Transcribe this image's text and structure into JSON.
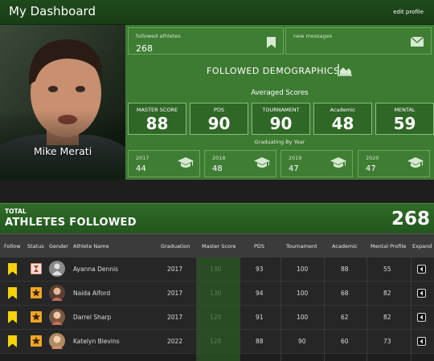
{
  "header": {
    "title": "My Dashboard",
    "edit_label": "edit profile"
  },
  "profile": {
    "name": "Mike Merati"
  },
  "stats": {
    "followed": {
      "label": "followed athletes",
      "value": "268",
      "icon": "bookmark-icon"
    },
    "messages": {
      "label": "new messages",
      "value": "",
      "icon": "envelope-icon"
    }
  },
  "demographics": {
    "title": "FOLLOWED DEMOGRAPHICS",
    "icon": "area-chart-icon"
  },
  "averaged": {
    "title": "Averaged Scores",
    "scores": [
      {
        "label": "MASTER SCORE",
        "value": "88"
      },
      {
        "label": "PDS",
        "value": "90"
      },
      {
        "label": "TOURNAMENT",
        "value": "90"
      },
      {
        "label": "Academic",
        "value": "48"
      },
      {
        "label": "MENTAL",
        "value": "59"
      }
    ]
  },
  "graduating": {
    "title": "Graduating By Year",
    "years": [
      {
        "year": "2017",
        "count": "44",
        "icon": "graduation-cap-icon"
      },
      {
        "year": "2018",
        "count": "48",
        "icon": "graduation-cap-icon"
      },
      {
        "year": "2019",
        "count": "47",
        "icon": "graduation-cap-icon"
      },
      {
        "year": "2020",
        "count": "47",
        "icon": "graduation-cap-icon"
      }
    ]
  },
  "total": {
    "small": "TOTAL",
    "big": "ATHLETES FOLLOWED",
    "count": "268"
  },
  "table": {
    "columns": [
      "Follow",
      "Status",
      "Gender",
      "Athlete Name",
      "Graduation",
      "Master Score",
      "PDS",
      "Tournament",
      "Academic",
      "Mental Profile",
      "Expand"
    ],
    "rows": [
      {
        "name": "Ayanna Dennis",
        "graduation": "2017",
        "master": "130",
        "pds": "93",
        "tournament": "100",
        "academic": "88",
        "mental": "55",
        "status": "hourglass-icon"
      },
      {
        "name": "Naida Alford",
        "graduation": "2017",
        "master": "130",
        "pds": "94",
        "tournament": "100",
        "academic": "68",
        "mental": "82",
        "status": "star-icon"
      },
      {
        "name": "Darrel Sharp",
        "graduation": "2017",
        "master": "129",
        "pds": "91",
        "tournament": "100",
        "academic": "62",
        "mental": "82",
        "status": "star-icon"
      },
      {
        "name": "Katelyn Blevins",
        "graduation": "2022",
        "master": "128",
        "pds": "88",
        "tournament": "90",
        "academic": "60",
        "mental": "73",
        "status": "star-icon"
      }
    ]
  },
  "colors": {
    "brand_green": "#3d7a32",
    "follow_yellow": "#f5d20a",
    "status_orange": "#f0a524"
  }
}
